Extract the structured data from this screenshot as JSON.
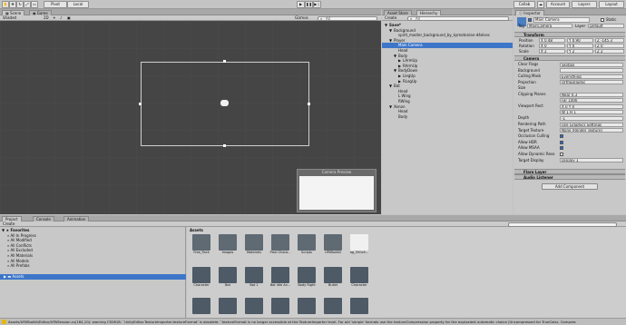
{
  "toolbar": {
    "pivot": "Pivot",
    "local": "Local",
    "collab": "Collab",
    "account": "Account",
    "layers": "Layers",
    "layout": "Layout"
  },
  "scene": {
    "tab_scene": "Scene",
    "tab_game": "Game",
    "shading": "Shaded",
    "mode_2d": "2D",
    "gizmos": "Gizmos",
    "search_all": "All",
    "camera_preview_title": "Camera Preview"
  },
  "hierarchy": {
    "tab_asset_store": "Asset Store",
    "tab_hierarchy": "Hierarchy",
    "create": "Create",
    "search_all": "All",
    "items": [
      {
        "label": "Save*",
        "level": 0,
        "arrow": "▼",
        "selected": false
      },
      {
        "label": "Background",
        "level": 1,
        "arrow": "▼",
        "selected": false
      },
      {
        "label": "spirit_master_background_by_kymotonian-d4elxsc",
        "level": 2,
        "arrow": "",
        "selected": false
      },
      {
        "label": "Player",
        "level": 1,
        "arrow": "▼",
        "selected": false
      },
      {
        "label": "Main Camera",
        "level": 2,
        "arrow": "",
        "selected": true
      },
      {
        "label": "Head",
        "level": 2,
        "arrow": "",
        "selected": false
      },
      {
        "label": "Body",
        "level": 2,
        "arrow": "▼",
        "selected": false
      },
      {
        "label": "LArmUp",
        "level": 3,
        "arrow": "▶",
        "selected": false
      },
      {
        "label": "RArmUp",
        "level": 3,
        "arrow": "▶",
        "selected": false
      },
      {
        "label": "BodyDown",
        "level": 2,
        "arrow": "▼",
        "selected": false
      },
      {
        "label": "LlegUp",
        "level": 3,
        "arrow": "▶",
        "selected": false
      },
      {
        "label": "RLegUp",
        "level": 3,
        "arrow": "▶",
        "selected": false
      },
      {
        "label": "Bat",
        "level": 1,
        "arrow": "▼",
        "selected": false
      },
      {
        "label": "Head",
        "level": 2,
        "arrow": "",
        "selected": false
      },
      {
        "label": "L Wing",
        "level": 2,
        "arrow": "",
        "selected": false
      },
      {
        "label": "RWing",
        "level": 2,
        "arrow": "",
        "selected": false
      },
      {
        "label": "Xenon",
        "level": 1,
        "arrow": "▼",
        "selected": false
      },
      {
        "label": "Head",
        "level": 2,
        "arrow": "",
        "selected": false
      },
      {
        "label": "Body",
        "level": 2,
        "arrow": "",
        "selected": false
      }
    ]
  },
  "inspector": {
    "tab": "Inspector",
    "object_name": "Main Camera",
    "static": "Static",
    "tag_label": "Tag",
    "tag_value": "MainCamera",
    "layer_label": "Layer",
    "layer_value": "Default",
    "transform": {
      "title": "Transform",
      "position_label": "Position",
      "rotation_label": "Rotation",
      "scale_label": "Scale",
      "position": [
        "X 0.48",
        "Y 0.90",
        "Z -145.3"
      ],
      "rotation": [
        "X 0",
        "Y 0",
        "Z 0"
      ],
      "scale": [
        "X 2",
        "Y 2",
        "Z 2"
      ]
    },
    "camera": {
      "title": "Camera",
      "rows": [
        {
          "label": "Clear Flags",
          "value": "Skybox"
        },
        {
          "label": "Background",
          "value": ""
        },
        {
          "label": "Culling Mask",
          "value": "Everything"
        },
        {
          "label": "Projection",
          "value": "Orthographic"
        },
        {
          "label": "Size",
          "value": ""
        },
        {
          "label": "Clipping Planes",
          "value": "Near  0.3"
        },
        {
          "label": "",
          "value": "Far   1000"
        },
        {
          "label": "Viewport Rect",
          "value": "X 0     Y 0"
        },
        {
          "label": "",
          "value": "W 1     H 1"
        },
        {
          "label": "Depth",
          "value": "-1"
        },
        {
          "label": "Rendering Path",
          "value": "Use Graphics Settings"
        },
        {
          "label": "Target Texture",
          "value": "None (Render Texture)"
        },
        {
          "label": "Occlusion Culling",
          "value": ""
        },
        {
          "label": "Allow HDR",
          "value": ""
        },
        {
          "label": "Allow MSAA",
          "value": ""
        },
        {
          "label": "Allow Dynamic Reso",
          "value": ""
        },
        {
          "label": "Target Display",
          "value": "Display 1"
        }
      ]
    },
    "flare_layer": "Flare Layer",
    "audio_listener": "Audio Listener",
    "add_component": "Add Component"
  },
  "project": {
    "tab_project": "Project",
    "tab_console": "Console",
    "tab_animation": "Animation",
    "create": "Create",
    "favorites": "Favorites",
    "favorite_items": [
      "All In Progress",
      "All Modified",
      "All Conflicts",
      "All Excluded",
      "All Materials",
      "All Models",
      "All Prefabs"
    ],
    "assets_root": "Assets",
    "breadcrumb": "Assets",
    "assets_row1": [
      "Free_Pack",
      "Images",
      "Materials",
      "Pixel Chara...",
      "Scripts",
      "UPAToolkit",
      "ag_550x5..."
    ],
    "assets_row2": [
      "Character",
      "Bat",
      "Bat 1",
      "Bat Idle An...",
      "Body Right",
      "Bullet",
      "Character"
    ],
    "assets_row3": [
      "",
      "",
      "",
      "",
      "",
      "",
      ""
    ]
  },
  "status": {
    "message": "Assets/UPAToolkit/Editor/UPASession.cs(184,10): warning CS0618: `UnityEditor.TextureImporter.textureFormat' is obsolete: `textureFormat is no longer accessible at the TextureImporter level. For old 'simple' formats use the textureCompression property for the equivalent automatic choice (Uncompressed for TrueColor, Compres"
  }
}
